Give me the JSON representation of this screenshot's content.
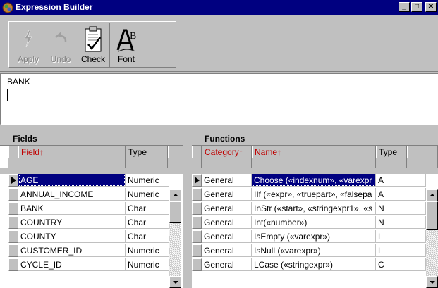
{
  "window": {
    "title": "Expression Builder"
  },
  "toolbar": {
    "apply_label": "Apply",
    "undo_label": "Undo",
    "check_label": "Check",
    "font_label": "Font"
  },
  "expression": {
    "text": "BANK"
  },
  "fields": {
    "title": "Fields",
    "columns": {
      "field": "Field",
      "type": "Type"
    },
    "rows": [
      {
        "field": "AGE",
        "type": "Numeric"
      },
      {
        "field": "ANNUAL_INCOME",
        "type": "Numeric"
      },
      {
        "field": "BANK",
        "type": "Char"
      },
      {
        "field": "COUNTRY",
        "type": "Char"
      },
      {
        "field": "COUNTY",
        "type": "Char"
      },
      {
        "field": "CUSTOMER_ID",
        "type": "Numeric"
      },
      {
        "field": "CYCLE_ID",
        "type": "Numeric"
      }
    ]
  },
  "functions": {
    "title": "Functions",
    "columns": {
      "category": "Category",
      "name": "Name",
      "type": "Type"
    },
    "rows": [
      {
        "category": "General",
        "name": "Choose («indexnum», «varexpr",
        "type": "A"
      },
      {
        "category": "General",
        "name": "IIf («expr», «truepart», «falsepa",
        "type": "A"
      },
      {
        "category": "General",
        "name": "InStr («start», «stringexpr1», «s",
        "type": "N"
      },
      {
        "category": "General",
        "name": "Int(«number»)",
        "type": "N"
      },
      {
        "category": "General",
        "name": "IsEmpty («varexpr»)",
        "type": "L"
      },
      {
        "category": "General",
        "name": "IsNull («varexpr»)",
        "type": "L"
      },
      {
        "category": "General",
        "name": "LCase («stringexpr»)",
        "type": "C"
      }
    ]
  },
  "colors": {
    "titlebar": "#000080",
    "selection": "#000080",
    "sorted_header": "#c00000"
  }
}
